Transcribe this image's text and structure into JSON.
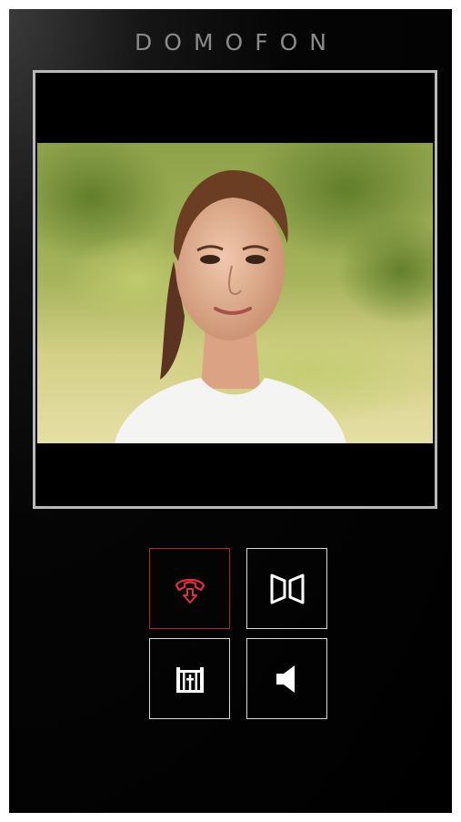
{
  "app": {
    "title": "DOMOFON"
  },
  "video": {
    "subject": "visitor-camera-feed"
  },
  "controls": [
    {
      "id": "hangup",
      "icon": "phone-hangup-icon",
      "color": "#e0303e"
    },
    {
      "id": "open-door",
      "icon": "double-door-icon",
      "color": "#ffffff"
    },
    {
      "id": "open-gate",
      "icon": "gate-icon",
      "color": "#ffffff"
    },
    {
      "id": "speaker",
      "icon": "speaker-icon",
      "color": "#ffffff"
    }
  ],
  "colors": {
    "background": "#000000",
    "frame_border": "#b9b9b9",
    "accent_red": "#e0303e",
    "button_border": "#d9d9d9"
  }
}
